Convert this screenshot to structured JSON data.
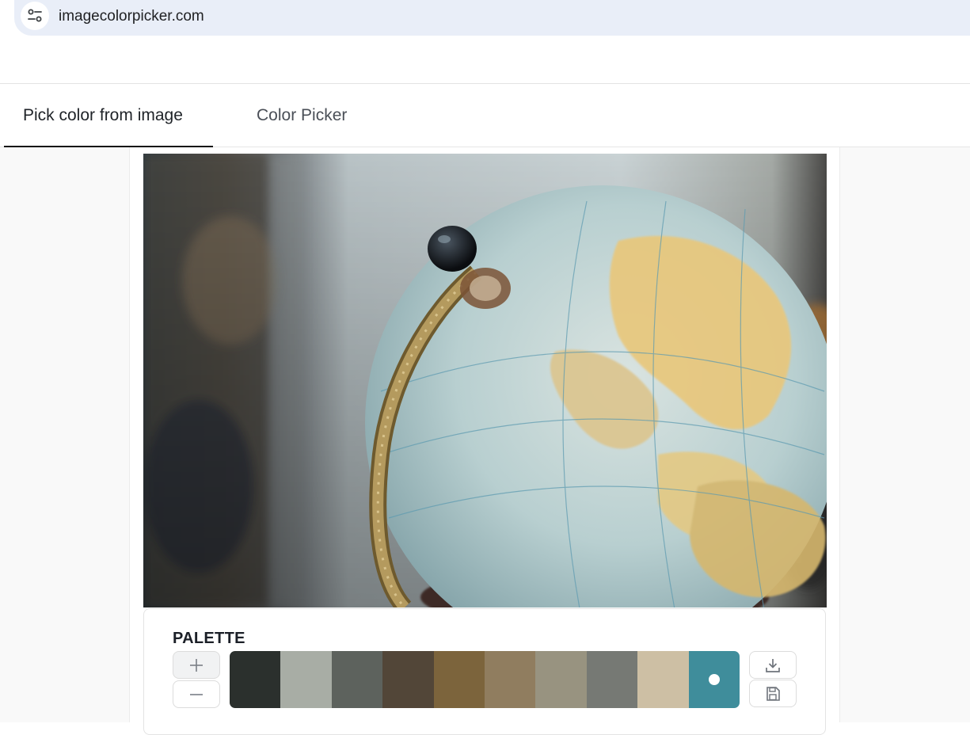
{
  "browser": {
    "url": "imagecolorpicker.com",
    "site_icon": "tune-settings-icon"
  },
  "tabs": [
    {
      "label": "Pick color from image",
      "active": true
    },
    {
      "label": "Color Picker",
      "active": false
    }
  ],
  "image": {
    "subject": "vintage globe",
    "icon": "globe-photo"
  },
  "palette": {
    "title": "PALETTE",
    "add_icon": "plus-icon",
    "remove_icon": "minus-icon",
    "download_icon": "download-icon",
    "save_icon": "save-icon",
    "selected_index": 9,
    "colors": [
      "#2b302d",
      "#a8ada5",
      "#5d625d",
      "#524638",
      "#7c643c",
      "#907d5f",
      "#989380",
      "#767974",
      "#cdbfa4",
      "#3f8d9b"
    ]
  }
}
